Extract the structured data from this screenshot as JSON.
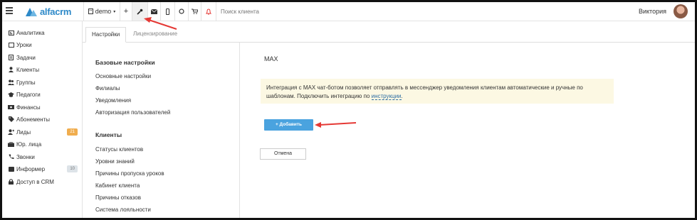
{
  "topbar": {
    "brand": "alfacrm",
    "branch": "demo",
    "search_placeholder": "Поиск клиента",
    "user_name": "Виктория"
  },
  "sidebar": {
    "items": [
      {
        "label": "Аналитика",
        "icon": "analytics-icon"
      },
      {
        "label": "Уроки",
        "icon": "lessons-icon"
      },
      {
        "label": "Задачи",
        "icon": "tasks-icon"
      },
      {
        "label": "Клиенты",
        "icon": "user-icon"
      },
      {
        "label": "Группы",
        "icon": "group-icon"
      },
      {
        "label": "Педагоги",
        "icon": "teacher-icon"
      },
      {
        "label": "Финансы",
        "icon": "finance-icon"
      },
      {
        "label": "Абонементы",
        "icon": "tag-icon"
      },
      {
        "label": "Лиды",
        "icon": "leads-icon",
        "badge": "21"
      },
      {
        "label": "Юр. лица",
        "icon": "briefcase-icon"
      },
      {
        "label": "Звонки",
        "icon": "phone-icon"
      },
      {
        "label": "Информер",
        "icon": "inbox-icon",
        "badge": "10"
      },
      {
        "label": "Доступ в CRM",
        "icon": "lock-icon"
      }
    ]
  },
  "tabs": [
    "Настройки",
    "Лицензирование"
  ],
  "menu": {
    "basic_heading": "Базовые настройки",
    "basic_items": [
      "Основные настройки",
      "Филиалы",
      "Уведомления",
      "Авторизация пользователей"
    ],
    "clients_heading": "Клиенты",
    "clients_items": [
      "Статусы клиентов",
      "Уровни знаний",
      "Причины пропуска уроков",
      "Кабинет клиента",
      "Причины отказов",
      "Система лояльности"
    ]
  },
  "content": {
    "title": "MAX",
    "notice_line1": "Интеграция с MAX чат-ботом позволяет отправлять в мессенджер уведомления клиентам автоматические и ручные по",
    "notice_line2_prefix": "шаблонам. Подключить интеграцию по",
    "notice_link": "инструкции",
    "notice_suffix": ".",
    "add_button": "+ Добавить",
    "cancel_button": "Отмена"
  },
  "colors": {
    "accent": "#4aa3df",
    "notice_bg": "#fcf8e3",
    "badge_orange": "#f0ad4e",
    "annotation_arrow": "#e53935"
  }
}
